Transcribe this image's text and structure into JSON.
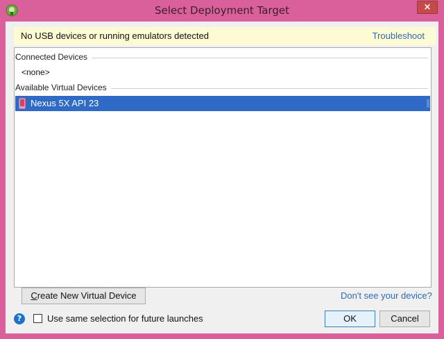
{
  "window": {
    "title": "Select Deployment Target",
    "close_label": "×"
  },
  "notice": {
    "text": "No USB devices or running emulators detected",
    "link": "Troubleshoot"
  },
  "devices": {
    "connected_header": "Connected Devices",
    "connected_none": "<none>",
    "virtual_header": "Available Virtual Devices",
    "virtual_items": [
      {
        "label": "Nexus 5X API 23",
        "selected": true,
        "icon": "phone-icon"
      }
    ]
  },
  "actions": {
    "create_prefix": "C",
    "create_rest": "reate New Virtual Device",
    "dont_see": "Don't see your device?",
    "help_label": "?",
    "remember_label": "Use same selection for future launches",
    "remember_checked": false,
    "ok_label": "OK",
    "cancel_label": "Cancel"
  },
  "colors": {
    "frame": "#d9609b",
    "selection": "#2f6bc6",
    "link": "#2e6ab8",
    "notice_bg": "#fdfbd3"
  }
}
